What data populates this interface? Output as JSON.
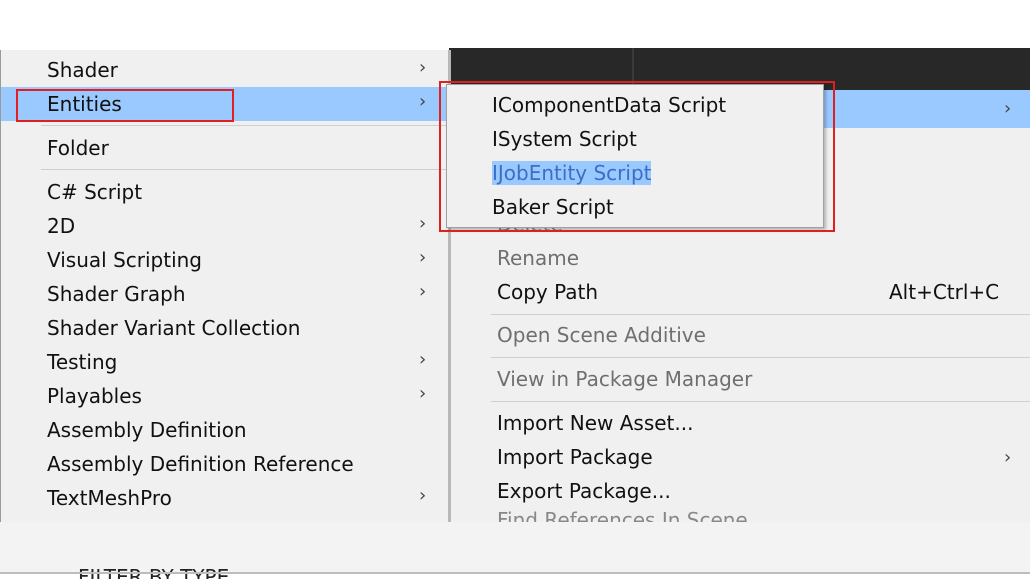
{
  "left_menu": {
    "items": [
      {
        "label": "Shader",
        "submenu": true
      },
      {
        "label": "Entities",
        "submenu": true,
        "highlighted": true
      },
      {
        "label": "Folder",
        "submenu": false
      },
      {
        "label": "C# Script",
        "submenu": false
      },
      {
        "label": "2D",
        "submenu": true
      },
      {
        "label": "Visual Scripting",
        "submenu": true
      },
      {
        "label": "Shader Graph",
        "submenu": true
      },
      {
        "label": "Shader Variant Collection",
        "submenu": false
      },
      {
        "label": "Testing",
        "submenu": true
      },
      {
        "label": "Playables",
        "submenu": true
      },
      {
        "label": "Assembly Definition",
        "submenu": false
      },
      {
        "label": "Assembly Definition Reference",
        "submenu": false
      },
      {
        "label": "TextMeshPro",
        "submenu": true
      }
    ],
    "arrow": "›"
  },
  "submenu": {
    "items": [
      {
        "label": "IComponentData Script"
      },
      {
        "label": "ISystem Script"
      },
      {
        "label": "IJobEntity Script",
        "selected": true
      },
      {
        "label": "Baker Script"
      }
    ]
  },
  "right_menu": {
    "partial_hidden_item": "Delete",
    "rename": "Rename",
    "copy_path": "Copy Path",
    "copy_path_shortcut": "Alt+Ctrl+C",
    "open_scene_additive": "Open Scene Additive",
    "view_in_package_manager": "View in Package Manager",
    "import_new_asset": "Import New Asset...",
    "import_package": "Import Package",
    "export_package": "Export Package...",
    "find_references": "Find References In Scene",
    "arrow": "›"
  },
  "colors": {
    "highlight": "#99c9ff",
    "annotation_red": "#e02020",
    "menu_bg": "#f0f0f0",
    "dark_bar": "#282828"
  },
  "background_text": "FILTER BY TYPE"
}
